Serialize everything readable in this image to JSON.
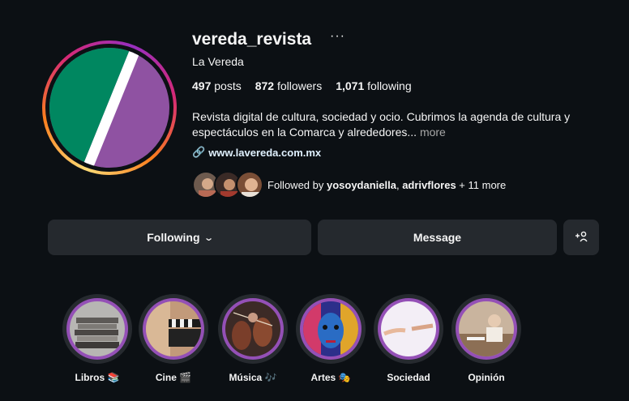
{
  "profile": {
    "username": "vereda_revista",
    "more_icon": "···",
    "full_name": "La Vereda",
    "stats": {
      "posts_count": "497",
      "posts_label": "posts",
      "followers_count": "872",
      "followers_label": "followers",
      "following_count": "1,071",
      "following_label": "following"
    },
    "bio": "Revista digital de cultura, sociedad y ocio. Cubrimos la agenda de cultura y espectáculos en la Comarca y alrededores...",
    "bio_more": "more",
    "link_icon": "🔗",
    "link": "www.lavereda.com.mx",
    "followed_by": {
      "prefix": "Followed by ",
      "user1": "yosoydaniella",
      "separator": ", ",
      "user2": "adrivflores",
      "suffix": " + 11 more"
    }
  },
  "actions": {
    "following_label": "Following",
    "following_chevron": "⌄",
    "message_label": "Message",
    "add_user_icon": "+👤"
  },
  "highlights": [
    {
      "label": "Libros 📚"
    },
    {
      "label": "Cine 🎬"
    },
    {
      "label": "Música 🎶"
    },
    {
      "label": "Artes 🎭"
    },
    {
      "label": "Sociedad"
    },
    {
      "label": "Opinión"
    }
  ],
  "colors": {
    "background": "#0c1014",
    "button": "#25292e",
    "highlight_ring": "#9450b6",
    "avatar_green": "#008760",
    "avatar_purple": "#8f52a2"
  }
}
